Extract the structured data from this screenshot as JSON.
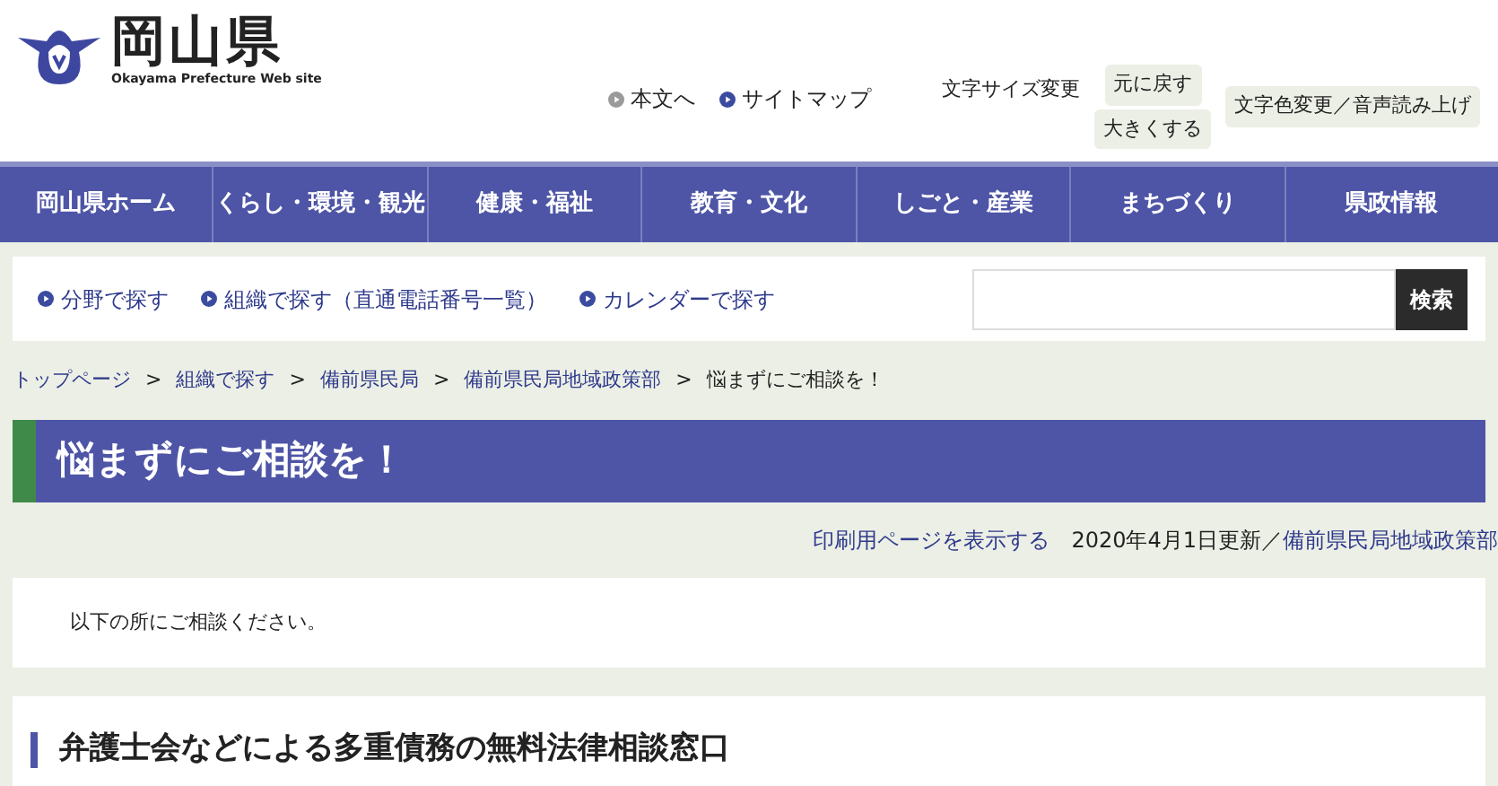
{
  "header": {
    "logo_title": "岡山県",
    "logo_subtitle": "Okayama Prefecture Web site",
    "skip_links": [
      {
        "label": "本文へ",
        "color": "#9a9a9a"
      },
      {
        "label": "サイトマップ",
        "color": "#3b4ba0"
      }
    ],
    "font_size_label": "文字サイズ変更",
    "font_size_buttons": [
      "元に戻す",
      "大きくする"
    ],
    "accessibility_button": "文字色変更／音声読み上げ"
  },
  "nav": [
    "岡山県ホーム",
    "くらし・環境・観光",
    "健康・福祉",
    "教育・文化",
    "しごと・産業",
    "まちづくり",
    "県政情報"
  ],
  "search_links": [
    "分野で探す",
    "組織で探す（直通電話番号一覧）",
    "カレンダーで探す"
  ],
  "search_button": "検索",
  "breadcrumb": {
    "links": [
      "トップページ",
      "組織で探す",
      "備前県民局",
      "備前県民局地域政策部"
    ],
    "current": "悩まずにご相談を！",
    "separator": ">"
  },
  "page_title": "悩まずにご相談を！",
  "meta": {
    "print_link": "印刷用ページを表示する",
    "updated": "2020年4月1日更新／",
    "department": "備前県民局地域政策部"
  },
  "intro": "以下の所にご相談ください。",
  "section_heading": "弁護士会などによる多重債務の無料法律相談窓口"
}
